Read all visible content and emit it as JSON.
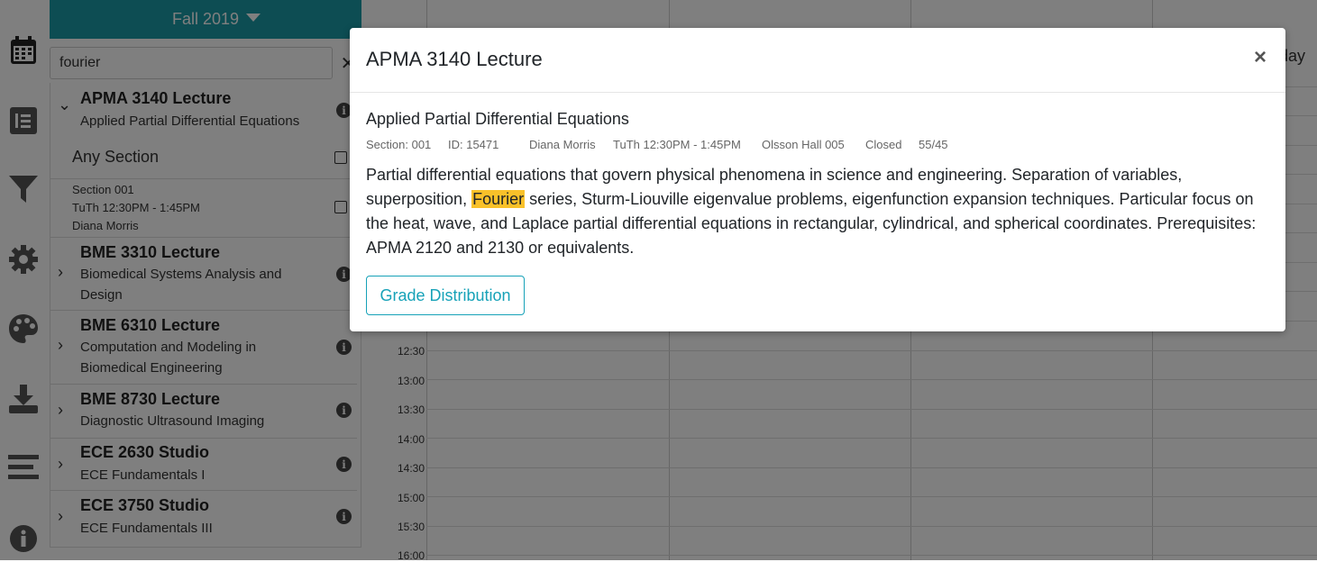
{
  "sidebar": {
    "semester": "Fall 2019",
    "search": {
      "value": "fourier"
    },
    "any_section_label": "Any Section",
    "section001": {
      "line1": "Section 001",
      "line2": "TuTh 12:30PM - 1:45PM",
      "line3": "Diana Morris"
    },
    "courses": [
      {
        "title": "APMA 3140 Lecture",
        "subtitle": "Applied Partial Differential Equations"
      },
      {
        "title": "BME 3310 Lecture",
        "subtitle": "Biomedical Systems Analysis and Design"
      },
      {
        "title": "BME 6310 Lecture",
        "subtitle": "Computation and Modeling in Biomedical Engineering"
      },
      {
        "title": "BME 8730 Lecture",
        "subtitle": "Diagnostic Ultrasound Imaging"
      },
      {
        "title": "ECE 2630 Studio",
        "subtitle": "ECE Fundamentals I"
      },
      {
        "title": "ECE 3750 Studio",
        "subtitle": "ECE Fundamentals III"
      }
    ]
  },
  "calendar": {
    "day_header_partial": "day",
    "times": [
      "12:30",
      "13:00",
      "13:30",
      "14:00",
      "14:30",
      "15:00",
      "15:30",
      "16:00"
    ]
  },
  "modal": {
    "title": "APMA 3140 Lecture",
    "close": "×",
    "course_name": "Applied Partial Differential Equations",
    "meta": {
      "section": "Section: 001",
      "id": "ID: 15471",
      "instructor": "Diana Morris",
      "time": "TuTh 12:30PM - 1:45PM",
      "location": "Olsson Hall 005",
      "status": "Closed",
      "enrollment": "55/45"
    },
    "description_before": "Partial differential equations that govern physical phenomena in science and engineering. Separation of variables, superposition, ",
    "description_highlight": "Fourier",
    "description_after": " series, Sturm-Liouville eigenvalue problems, eigenfunction expansion techniques. Particular focus on the heat, wave, and Laplace partial differential equations in rectangular, cylindrical, and spherical coordinates. Prerequisites: APMA 2120 and 2130 or equivalents.",
    "grade_button": "Grade Distribution"
  },
  "colors": {
    "accent": "#1a9aa6",
    "highlight": "#f9c12a",
    "button": "#17a2b8"
  },
  "icons": [
    "calendar-icon",
    "list-icon",
    "filter-icon",
    "gear-icon",
    "palette-icon",
    "download-icon",
    "menu-icon",
    "info-icon"
  ]
}
